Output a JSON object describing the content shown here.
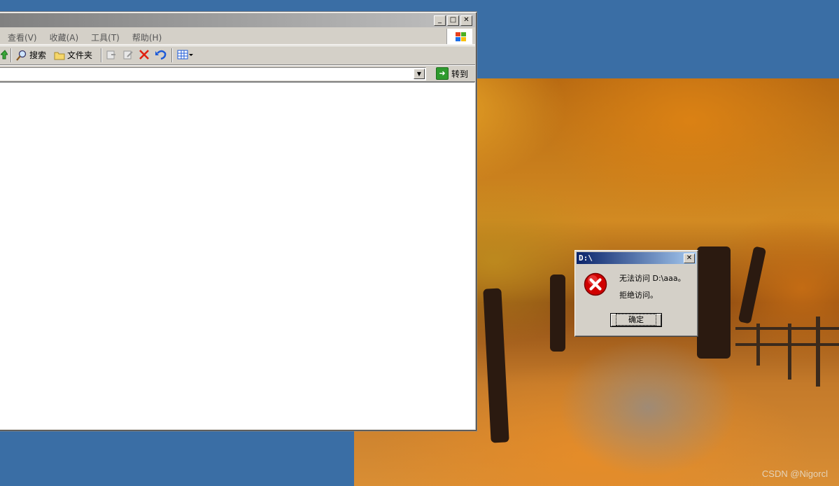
{
  "explorer": {
    "menu": [
      "查看(V)",
      "收藏(A)",
      "工具(T)",
      "帮助(H)"
    ],
    "toolbar": {
      "search_label": "搜索",
      "folders_label": "文件夹"
    },
    "address": {
      "value": "",
      "go_label": "转到"
    },
    "title_buttons": {
      "minimize": "_",
      "maximize": "□",
      "close": "✕"
    }
  },
  "dialog": {
    "title": "D:\\",
    "message_line1": "无法访问 D:\\aaa。",
    "message_line2": "拒绝访问。",
    "ok_label": "确定",
    "close_glyph": "✕"
  },
  "desktop": {
    "watermark": "CSDN @Nigorcl"
  },
  "colors": {
    "desktop_bg": "#3a6ea5",
    "dialog_title_start": "#0a246a",
    "error_red": "#d00000"
  }
}
